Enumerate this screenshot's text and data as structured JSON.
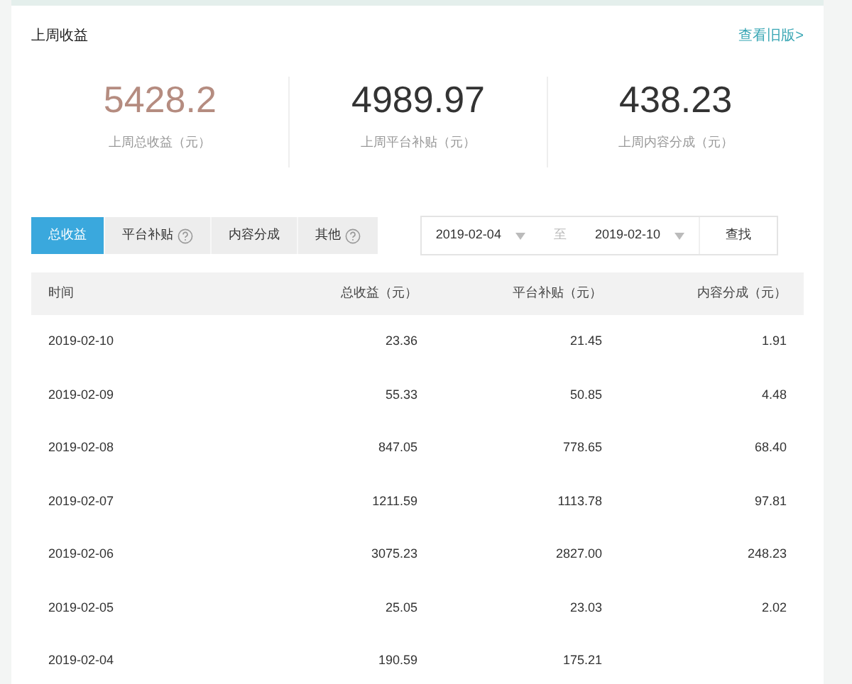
{
  "header": {
    "title": "上周收益",
    "link": "查看旧版>"
  },
  "stats": [
    {
      "value": "5428.2",
      "label": "上周总收益（元）",
      "color": "#b58c80"
    },
    {
      "value": "4989.97",
      "label": "上周平台补贴（元）",
      "color": "#333333"
    },
    {
      "value": "438.23",
      "label": "上周内容分成（元）",
      "color": "#333333"
    }
  ],
  "tabs": [
    {
      "label": "总收益",
      "selected": true,
      "help": false
    },
    {
      "label": "平台补贴",
      "selected": false,
      "help": true
    },
    {
      "label": "内容分成",
      "selected": false,
      "help": false
    },
    {
      "label": "其他",
      "selected": false,
      "help": true
    }
  ],
  "date_range": {
    "start": "2019-02-04",
    "separator": "至",
    "end": "2019-02-10",
    "button": "查找"
  },
  "table": {
    "columns": [
      "时间",
      "总收益（元）",
      "平台补贴（元）",
      "内容分成（元）"
    ],
    "rows": [
      [
        "2019-02-10",
        "23.36",
        "21.45",
        "1.91"
      ],
      [
        "2019-02-09",
        "55.33",
        "50.85",
        "4.48"
      ],
      [
        "2019-02-08",
        "847.05",
        "778.65",
        "68.40"
      ],
      [
        "2019-02-07",
        "1211.59",
        "1113.78",
        "97.81"
      ],
      [
        "2019-02-06",
        "3075.23",
        "2827.00",
        "248.23"
      ],
      [
        "2019-02-05",
        "25.05",
        "23.03",
        "2.02"
      ],
      [
        "2019-02-04",
        "190.59",
        "175.21"
      ]
    ]
  }
}
